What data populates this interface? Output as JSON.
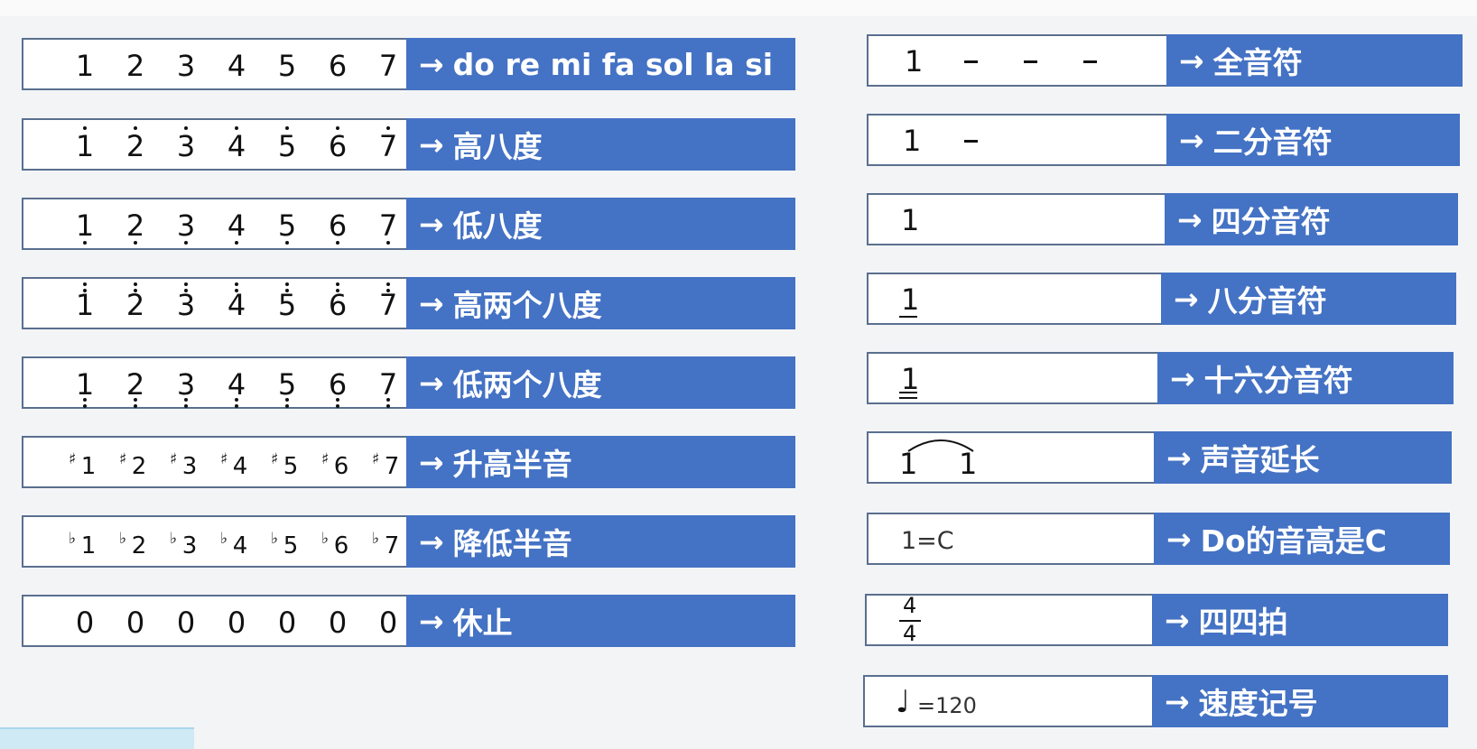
{
  "colors": {
    "label_bg": "#4472c4",
    "label_text": "#ffffff",
    "box_border": "#5a6f8f"
  },
  "arrow": "→",
  "left_rows": [
    {
      "notes": [
        "1",
        "2",
        "3",
        "4",
        "5",
        "6",
        "7"
      ],
      "label": "do re mi fa sol la si"
    },
    {
      "notes": [
        "1",
        "2",
        "3",
        "4",
        "5",
        "6",
        "7"
      ],
      "label": "高八度"
    },
    {
      "notes": [
        "1",
        "2",
        "3",
        "4",
        "5",
        "6",
        "7"
      ],
      "label": "低八度"
    },
    {
      "notes": [
        "1",
        "2",
        "3",
        "4",
        "5",
        "6",
        "7"
      ],
      "label": "高两个八度"
    },
    {
      "notes": [
        "1",
        "2",
        "3",
        "4",
        "5",
        "6",
        "7"
      ],
      "label": "低两个八度"
    },
    {
      "notes": [
        "1",
        "2",
        "3",
        "4",
        "5",
        "6",
        "7"
      ],
      "accidental": "♯",
      "label": "升高半音"
    },
    {
      "notes": [
        "1",
        "2",
        "3",
        "4",
        "5",
        "6",
        "7"
      ],
      "accidental": "♭",
      "label": "降低半音"
    },
    {
      "notes": [
        "0",
        "0",
        "0",
        "0",
        "0",
        "0",
        "0"
      ],
      "label": "休止"
    }
  ],
  "right_rows": [
    {
      "note": "1",
      "label": "全音符"
    },
    {
      "note": "1",
      "label": "二分音符"
    },
    {
      "note": "1",
      "label": "四分音符"
    },
    {
      "note": "1",
      "label": "八分音符"
    },
    {
      "note": "1",
      "label": "十六分音符"
    },
    {
      "note": "1",
      "note2": "1",
      "label": "声音延长"
    },
    {
      "key": "1=C",
      "label": "Do的音高是C"
    },
    {
      "numerator": "4",
      "denominator": "4",
      "label": "四四拍"
    },
    {
      "tempo_symbol": "♩",
      "tempo": "=120",
      "label": "速度记号"
    }
  ]
}
